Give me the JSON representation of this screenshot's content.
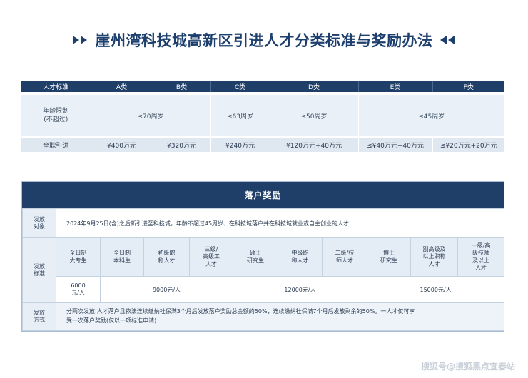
{
  "page": {
    "title": "崖州湾科技城高新区引进人才分类标准与奖励办法",
    "accent_color": "#1f3f69",
    "left_arrows_icon": "double-play-arrow-right",
    "right_arrows_icon": "double-play-arrow-left"
  },
  "talent_table": {
    "header": [
      "人才标准",
      "A类",
      "B类",
      "C类",
      "D类",
      "E类",
      "F类"
    ],
    "age_label_line1": "年龄限制",
    "age_label_line2": "(不超过)",
    "age_limits": [
      "≤70周岁",
      "≤63周岁",
      "≤50周岁",
      "≤45周岁"
    ],
    "fulltime_label": "全职引进",
    "fulltime_values": [
      "¥400万元",
      "¥320万元",
      "¥240万元",
      "¥120万元+40万元",
      "≤¥40万元+40万元",
      "≤¥20万元+20万元"
    ]
  },
  "settlement": {
    "title": "落户奖励",
    "target_label_line1": "发放",
    "target_label_line2": "对象",
    "target_text": "2024年9月25日(含)之后新引进至科技城，年龄不超过45周岁、在科技城落户并在科技城就业或自主创业的人才",
    "standard_label_line1": "发放",
    "standard_label_line2": "标准",
    "categories": [
      [
        "全日制",
        "大专生"
      ],
      [
        "全日制",
        "本科生"
      ],
      [
        "初级职",
        "称人才"
      ],
      [
        "三级/",
        "高级工",
        "人才"
      ],
      [
        "硕士",
        "研究生"
      ],
      [
        "中级职",
        "称人才"
      ],
      [
        "二级/技",
        "师人才"
      ],
      [
        "博士",
        "研究生"
      ],
      [
        "副高级及",
        "以上职称",
        "人才"
      ],
      [
        "一级/高",
        "级技师",
        "及以上",
        "人才"
      ]
    ],
    "amount_1_line1": "6000",
    "amount_1_line2": "元/人",
    "amount_2": "9000元/人",
    "amount_3": "12000元/人",
    "amount_4": "15000元/人",
    "method_label_line1": "发放",
    "method_label_line2": "方式",
    "method_text_line1": "分两次发放:人才落户且依法连续缴纳社保满3个月后发放落户奖励总金额的50%，连续缴纳社保满7个月后发放剩余的50%。一人才仅可享",
    "method_text_line2": "受一次落户奖励(仅以一项标准申请)"
  },
  "watermark": "搜狐号@搜狐黑点宜春站"
}
